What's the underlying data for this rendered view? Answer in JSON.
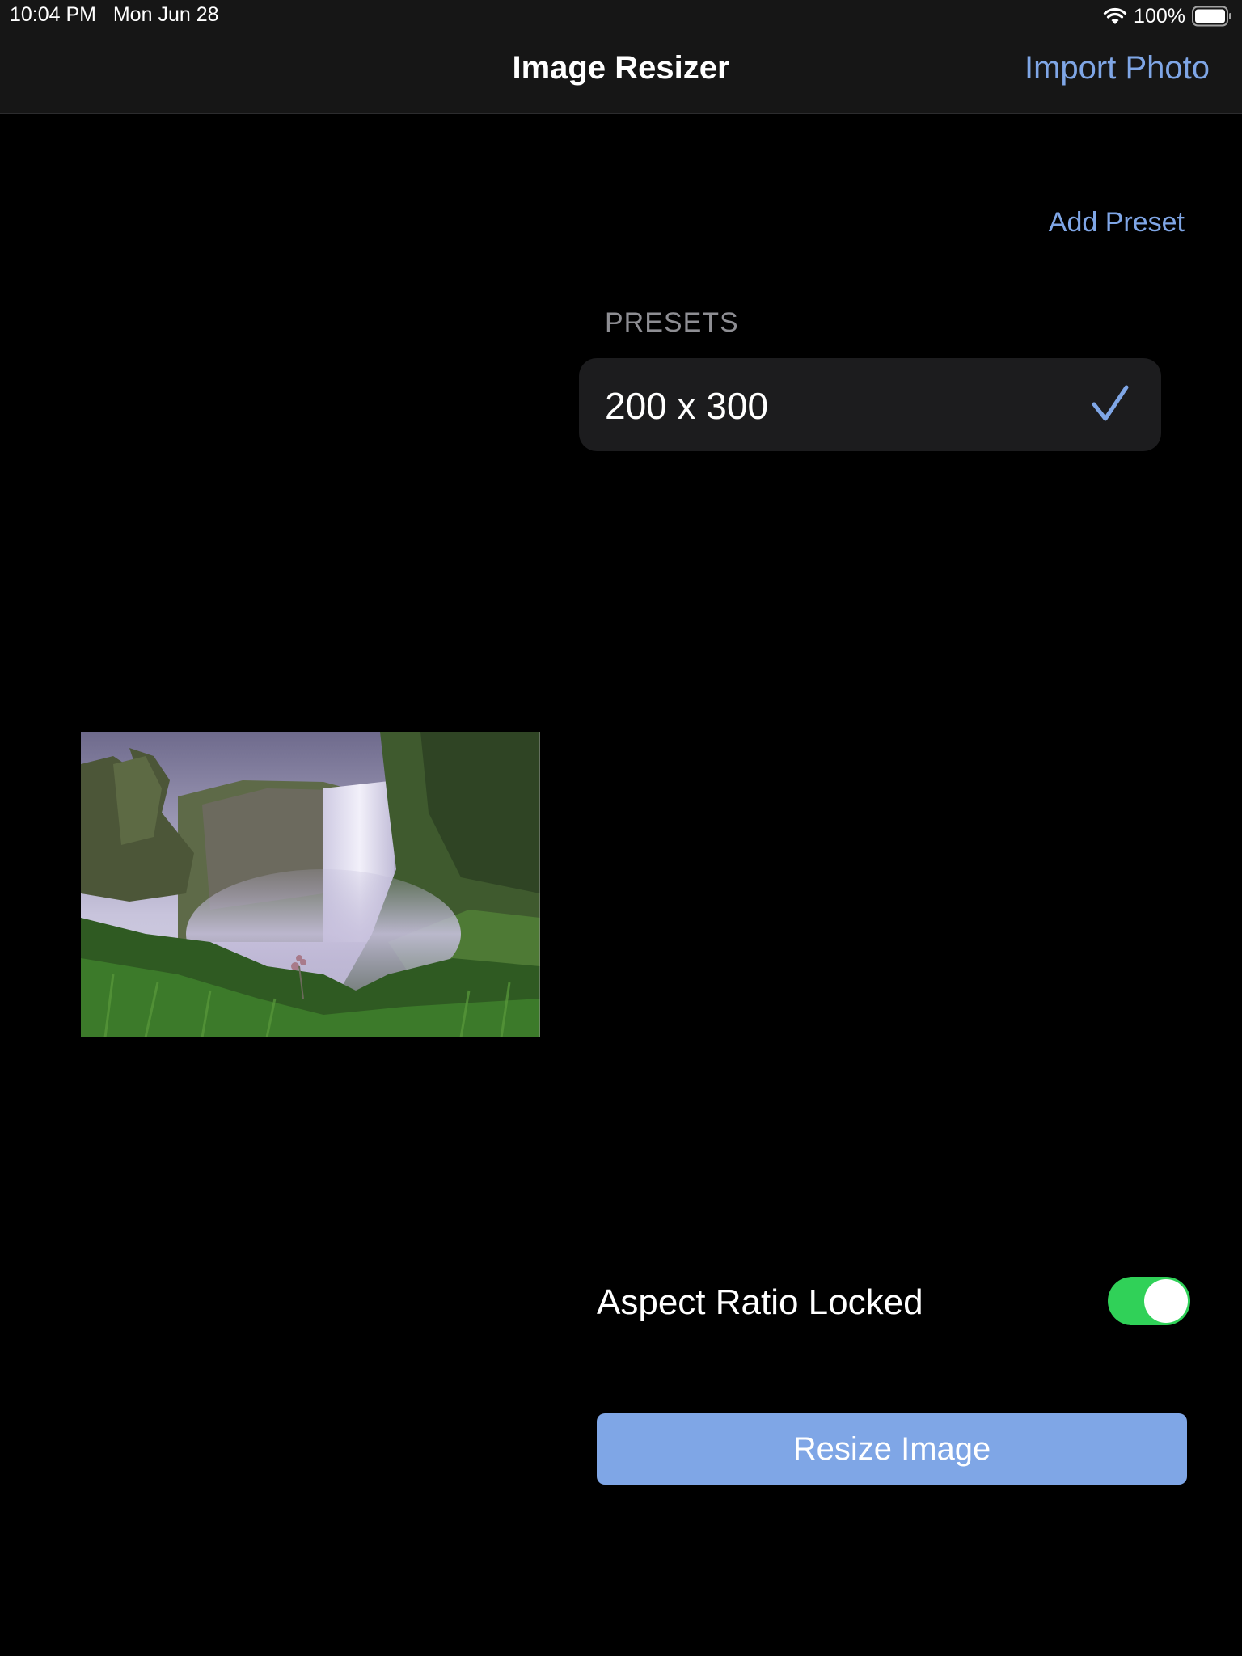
{
  "status_bar": {
    "time": "10:04 PM",
    "date": "Mon Jun 28",
    "battery": "100%",
    "wifi_icon": "wifi-icon",
    "battery_icon": "battery-icon"
  },
  "nav": {
    "title": "Image Resizer",
    "import_label": "Import Photo"
  },
  "presets": {
    "add_label": "Add Preset",
    "header": "PRESETS",
    "items": [
      {
        "label": "200 x 300",
        "selected": true
      }
    ]
  },
  "photo": {
    "icon": "waterfall-photo"
  },
  "options": {
    "aspect_label": "Aspect Ratio Locked",
    "aspect_locked": true
  },
  "actions": {
    "resize_label": "Resize Image"
  },
  "colors": {
    "accent": "#7fa6e6",
    "toggle_on": "#30d158",
    "background": "#000000",
    "header_bg": "#161616",
    "row_bg": "#1c1c1e"
  }
}
